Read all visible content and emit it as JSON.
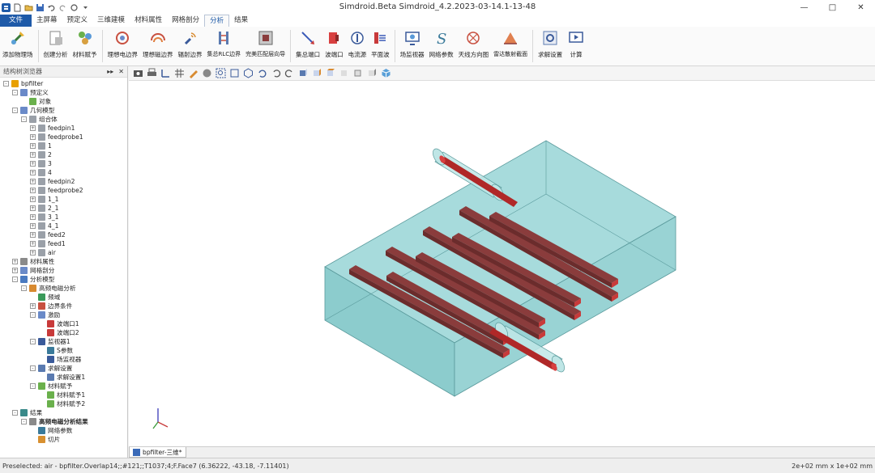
{
  "app": {
    "title": "Simdroid.Beta  Simdroid_4.2.2023-03-14.1-13-48"
  },
  "window_controls": {
    "minimize": "—",
    "maximize": "□",
    "close": "✕"
  },
  "menu": [
    "文件",
    "主屏幕",
    "预定义",
    "三维建模",
    "材料属性",
    "网格剖分",
    "分析",
    "结果"
  ],
  "ribbon": [
    {
      "label": "添加物理场",
      "icon": "physics-field-icon"
    },
    {
      "label": "创建分析",
      "icon": "create-analysis-icon"
    },
    {
      "label": "材料赋予",
      "icon": "material-assign-icon"
    },
    {
      "label": "理想电边界",
      "icon": "pec-boundary-icon"
    },
    {
      "label": "理想磁边界",
      "icon": "pmc-boundary-icon"
    },
    {
      "label": "辐射边界",
      "icon": "radiation-boundary-icon"
    },
    {
      "label": "集总RLC边界",
      "icon": "rlc-boundary-icon"
    },
    {
      "label": "完美匹配层向导",
      "icon": "pml-wizard-icon"
    },
    {
      "label": "集总端口",
      "icon": "lumped-port-icon"
    },
    {
      "label": "波端口",
      "icon": "wave-port-icon"
    },
    {
      "label": "电流源",
      "icon": "current-source-icon"
    },
    {
      "label": "平面波",
      "icon": "plane-wave-icon"
    },
    {
      "label": "场监视器",
      "icon": "field-monitor-icon"
    },
    {
      "label": "网络参数",
      "icon": "network-param-icon"
    },
    {
      "label": "天线方向图",
      "icon": "antenna-pattern-icon"
    },
    {
      "label": "雷达散射截面",
      "icon": "rcs-icon"
    },
    {
      "label": "求解设置",
      "icon": "solver-settings-icon"
    },
    {
      "label": "计算",
      "icon": "compute-icon"
    }
  ],
  "panel": {
    "title": "结构树浏览器",
    "pin": "▸▸",
    "close": "✕"
  },
  "tree": [
    {
      "label": "bpfilter",
      "depth": 0,
      "tog": "-",
      "icon": "#e8a000",
      "bold": false
    },
    {
      "label": "预定义",
      "depth": 1,
      "tog": "-",
      "icon": "#6a8ac8"
    },
    {
      "label": "对象",
      "depth": 2,
      "tog": "",
      "icon": "#6ab04c"
    },
    {
      "label": "几何模型",
      "depth": 1,
      "tog": "-",
      "icon": "#6a8ac8"
    },
    {
      "label": "组合体",
      "depth": 2,
      "tog": "-",
      "icon": "#9aa0a8"
    },
    {
      "label": "feedpin1",
      "depth": 3,
      "tog": "+",
      "icon": "#9aa0a8"
    },
    {
      "label": "feedprobe1",
      "depth": 3,
      "tog": "+",
      "icon": "#9aa0a8"
    },
    {
      "label": "1",
      "depth": 3,
      "tog": "+",
      "icon": "#9aa0a8"
    },
    {
      "label": "2",
      "depth": 3,
      "tog": "+",
      "icon": "#9aa0a8"
    },
    {
      "label": "3",
      "depth": 3,
      "tog": "+",
      "icon": "#9aa0a8"
    },
    {
      "label": "4",
      "depth": 3,
      "tog": "+",
      "icon": "#9aa0a8"
    },
    {
      "label": "feedpin2",
      "depth": 3,
      "tog": "+",
      "icon": "#9aa0a8"
    },
    {
      "label": "feedprobe2",
      "depth": 3,
      "tog": "+",
      "icon": "#9aa0a8"
    },
    {
      "label": "1_1",
      "depth": 3,
      "tog": "+",
      "icon": "#9aa0a8"
    },
    {
      "label": "2_1",
      "depth": 3,
      "tog": "+",
      "icon": "#9aa0a8"
    },
    {
      "label": "3_1",
      "depth": 3,
      "tog": "+",
      "icon": "#9aa0a8"
    },
    {
      "label": "4_1",
      "depth": 3,
      "tog": "+",
      "icon": "#9aa0a8"
    },
    {
      "label": "feed2",
      "depth": 3,
      "tog": "+",
      "icon": "#9aa0a8"
    },
    {
      "label": "feed1",
      "depth": 3,
      "tog": "+",
      "icon": "#9aa0a8"
    },
    {
      "label": "air",
      "depth": 3,
      "tog": "+",
      "icon": "#9aa0a8"
    },
    {
      "label": "材料属性",
      "depth": 1,
      "tog": "+",
      "icon": "#8a8a8a"
    },
    {
      "label": "网格剖分",
      "depth": 1,
      "tog": "+",
      "icon": "#6a8ac8"
    },
    {
      "label": "分析模型",
      "depth": 1,
      "tog": "-",
      "icon": "#4a7ac0"
    },
    {
      "label": "高频电磁分析",
      "depth": 2,
      "tog": "-",
      "icon": "#d88a30"
    },
    {
      "label": "频域",
      "depth": 3,
      "tog": "",
      "icon": "#3a9a5a"
    },
    {
      "label": "边界条件",
      "depth": 3,
      "tog": "+",
      "icon": "#c85040"
    },
    {
      "label": "激励",
      "depth": 3,
      "tog": "-",
      "icon": "#6a8ac8"
    },
    {
      "label": "波端口1",
      "depth": 4,
      "tog": "",
      "icon": "#c83a3a"
    },
    {
      "label": "波端口2",
      "depth": 4,
      "tog": "",
      "icon": "#c83a3a"
    },
    {
      "label": "监视器1",
      "depth": 3,
      "tog": "-",
      "icon": "#3a5a9a"
    },
    {
      "label": "S参数",
      "depth": 4,
      "tog": "",
      "icon": "#3a7a9a"
    },
    {
      "label": "场监视器",
      "depth": 4,
      "tog": "",
      "icon": "#3a5a9a"
    },
    {
      "label": "求解设置",
      "depth": 3,
      "tog": "-",
      "icon": "#5a7ab0"
    },
    {
      "label": "求解设置1",
      "depth": 4,
      "tog": "",
      "icon": "#5a7ab0"
    },
    {
      "label": "材料赋予",
      "depth": 3,
      "tog": "-",
      "icon": "#6ab04c"
    },
    {
      "label": "材料赋予1",
      "depth": 4,
      "tog": "",
      "icon": "#6ab04c"
    },
    {
      "label": "材料赋予2",
      "depth": 4,
      "tog": "",
      "icon": "#6ab04c"
    },
    {
      "label": "结果",
      "depth": 1,
      "tog": "-",
      "icon": "#3a8a8a"
    },
    {
      "label": "高频电磁分析结果",
      "depth": 2,
      "tog": "-",
      "icon": "#8a8a8a",
      "bold": true
    },
    {
      "label": "网络参数",
      "depth": 3,
      "tog": "",
      "icon": "#3a7a9a"
    },
    {
      "label": "切片",
      "depth": 3,
      "tog": "",
      "icon": "#d89030"
    }
  ],
  "doc_tab": {
    "label": "bpfilter-三维*"
  },
  "status": {
    "preselected": "Preselected: air - bpfilter.Overlap14;;#121;;T1037;4;F.Face7 (6.36222, -43.18, -7.11401)",
    "dimensions": "2e+02 mm x 1e+02 mm"
  },
  "colors": {
    "accent": "#1e5aa8",
    "box": "#9fd6d6",
    "resonator": "#8a3c3c",
    "probe": "#b02828"
  }
}
